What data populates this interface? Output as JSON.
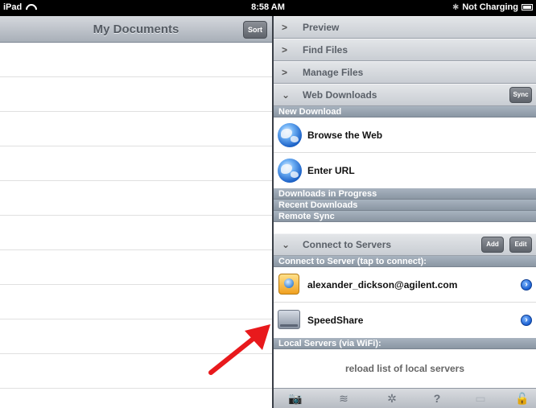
{
  "status_bar": {
    "device": "iPad",
    "time": "8:58 AM",
    "battery_status": "Not Charging"
  },
  "left_pane": {
    "title": "My Documents",
    "sort_label": "Sort",
    "row_count": 10
  },
  "right_pane": {
    "sections": {
      "preview": "Preview",
      "find_files": "Find Files",
      "manage_files": "Manage Files",
      "web_downloads": "Web Downloads",
      "connect_to_servers": "Connect to Servers"
    },
    "sync_label": "Sync",
    "add_label": "Add",
    "edit_label": "Edit",
    "web": {
      "new_download_header": "New Download",
      "browse_web": "Browse the Web",
      "enter_url": "Enter URL",
      "downloads_in_progress": "Downloads in Progress",
      "recent_downloads": "Recent Downloads",
      "remote_sync": "Remote Sync"
    },
    "servers": {
      "connect_header": "Connect to Server (tap to connect):",
      "items": [
        {
          "label": "alexander_dickson@agilent.com",
          "icon": "server-icon"
        },
        {
          "label": "SpeedShare",
          "icon": "disk-icon"
        }
      ],
      "local_header": "Local Servers (via WiFi):",
      "reload_label": "reload list of local servers"
    },
    "toolbar_icons": [
      "camera-icon",
      "wifi-icon",
      "gear-icon",
      "help-icon",
      "screen-icon",
      "lock-icon"
    ]
  },
  "colors": {
    "sub_header": "#94a0ad",
    "annotation_arrow": "#e8191c"
  }
}
